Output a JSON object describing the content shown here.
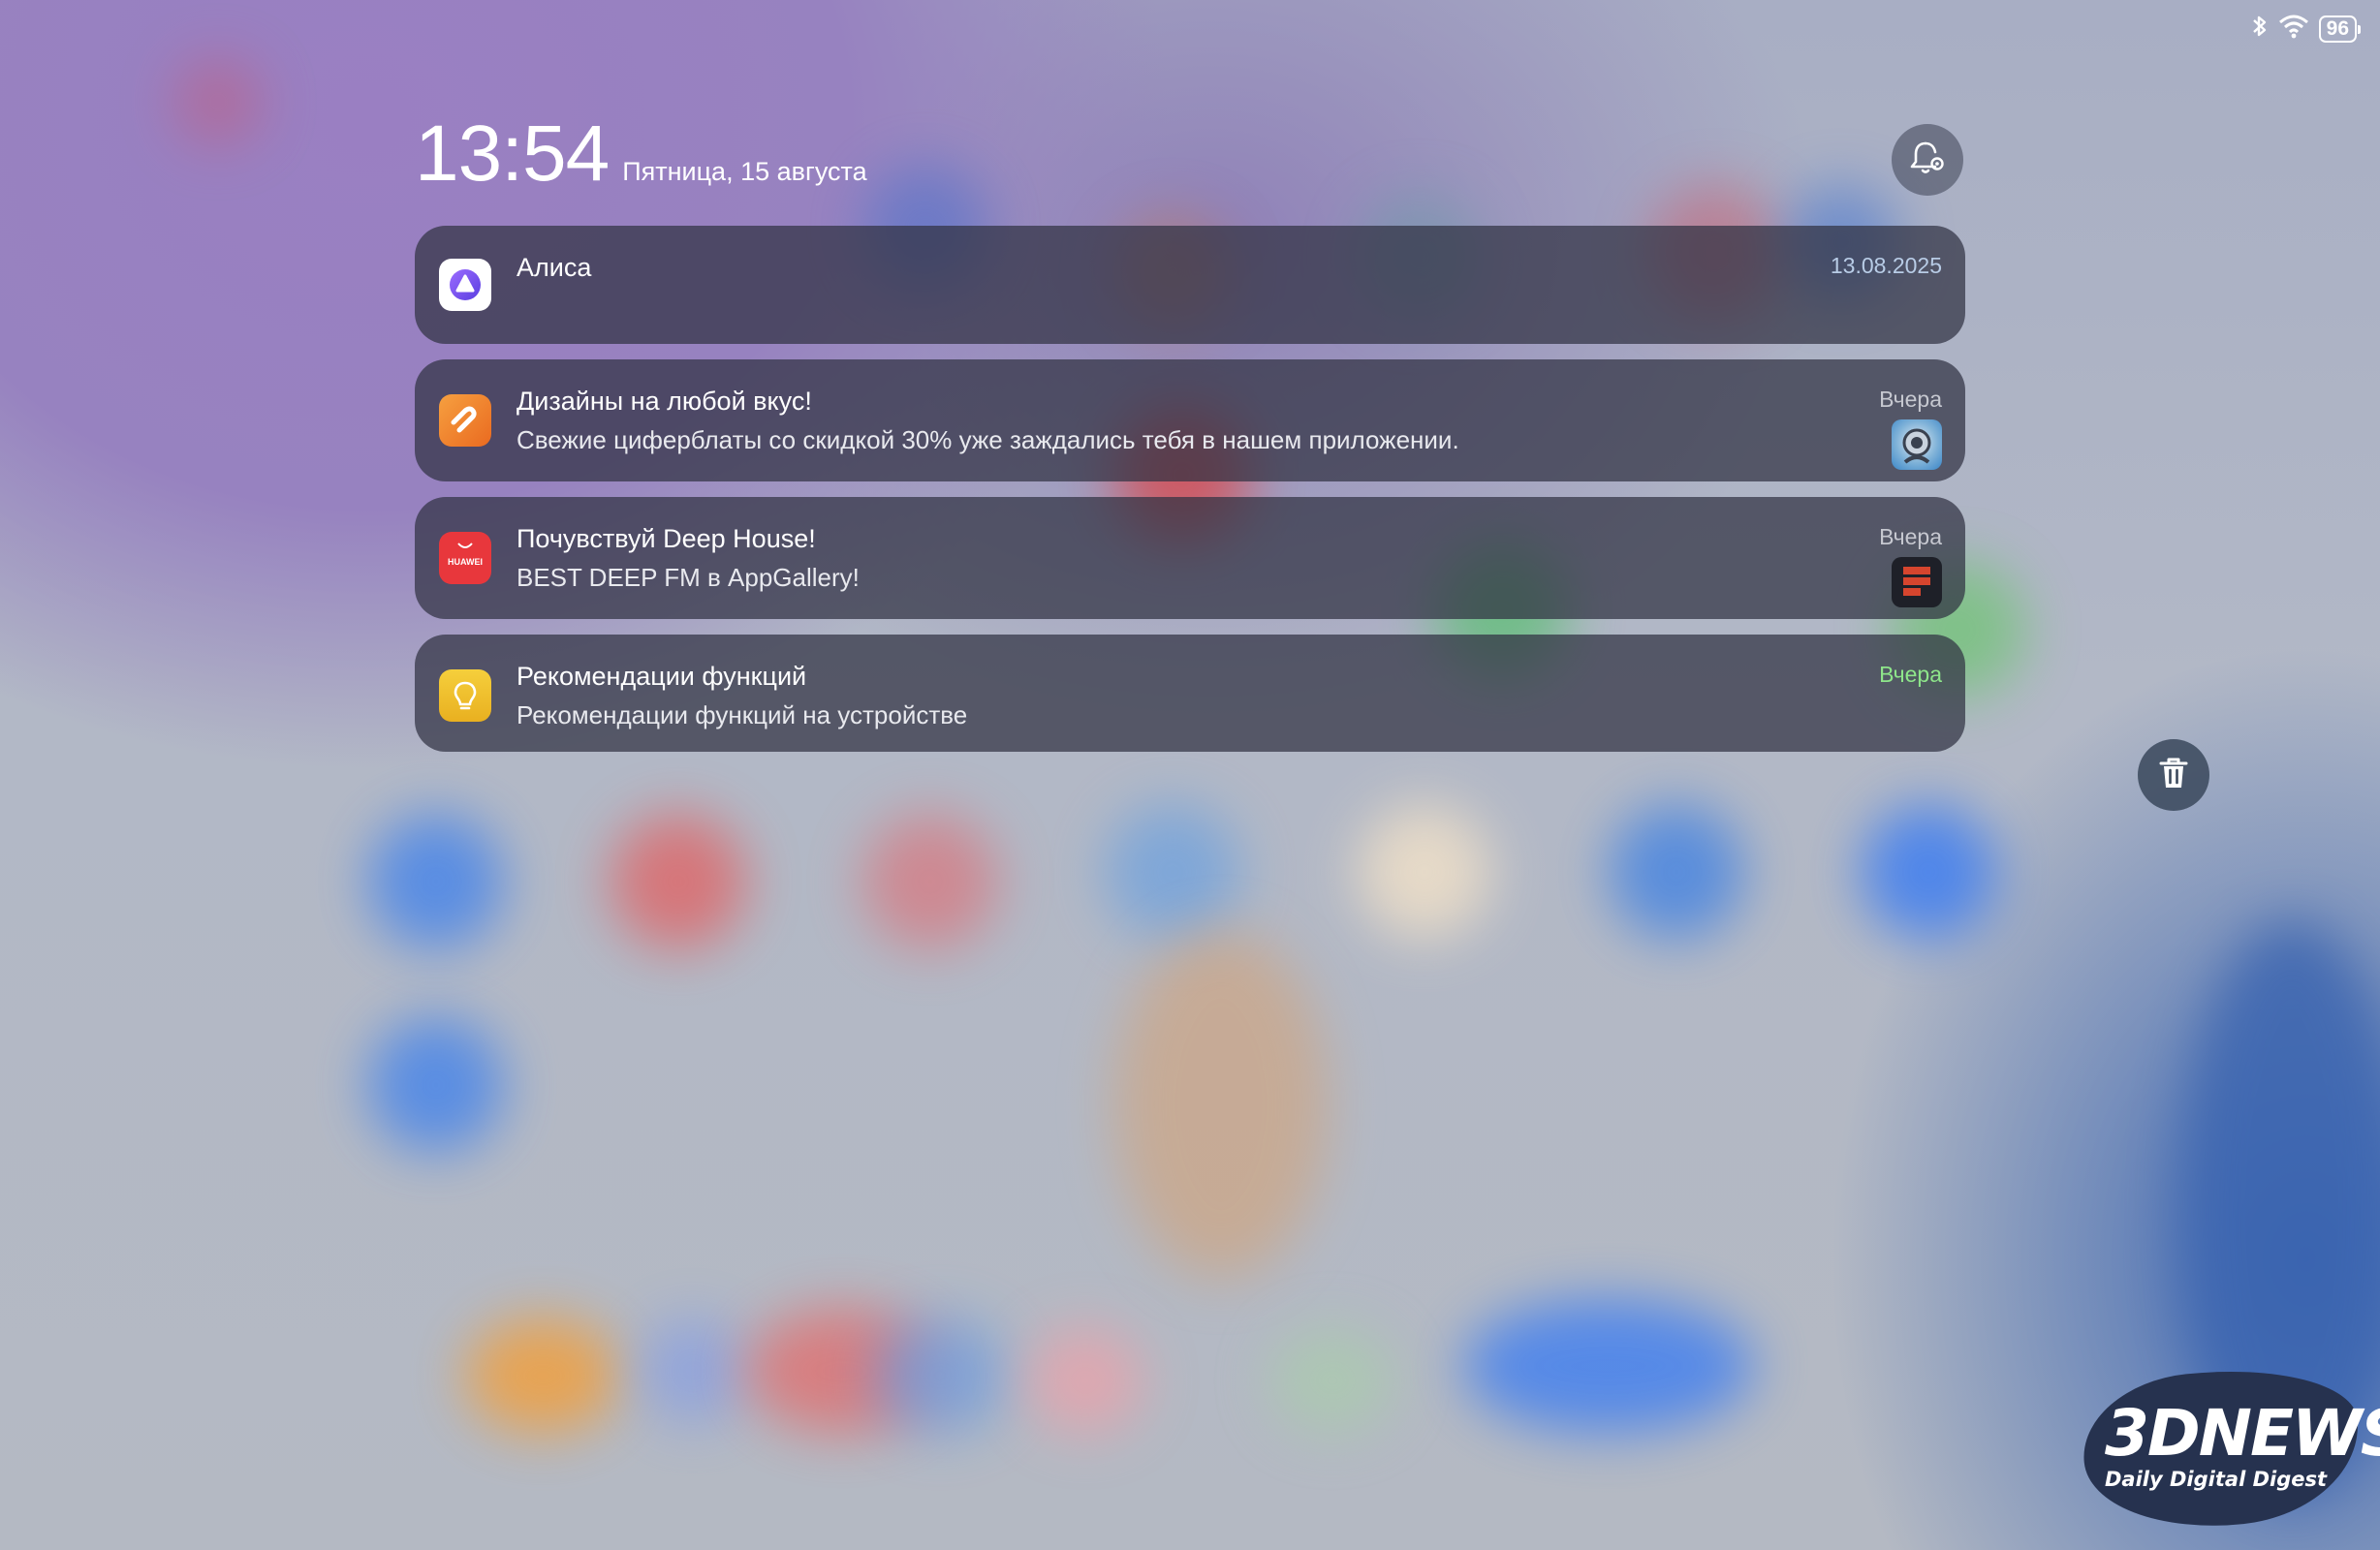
{
  "status_bar": {
    "bluetooth_icon": "bluetooth-icon",
    "wifi_icon": "wifi-icon",
    "battery_level": "96"
  },
  "lock_header": {
    "time": "13:54",
    "date": "Пятница, 15 августа",
    "settings_icon": "bell-settings-icon"
  },
  "notifications": [
    {
      "app": "Алиса",
      "icon": "alice-app-icon",
      "title": "Алиса",
      "body": "",
      "time": "13.08.2025",
      "time_color": "#b8cce6"
    },
    {
      "app": "Дизайны",
      "icon": "themes-app-icon",
      "title": "Дизайны на любой вкус!",
      "body": "Свежие циферблаты со скидкой 30% уже заждались тебя в нашем приложении.",
      "time": "Вчера",
      "thumbnail": "watchface-thumbnail"
    },
    {
      "app": "AppGallery",
      "icon": "huawei-appgallery-icon",
      "icon_label": "HUAWEI",
      "title": "Почувствуй Deep House!",
      "body": "BEST DEEP FM в AppGallery!",
      "time": "Вчера",
      "thumbnail": "best-deep-fm-thumbnail"
    },
    {
      "app": "Советы",
      "icon": "tips-lightbulb-icon",
      "title": "Рекомендации функций",
      "body": "Рекомендации функций на устройстве",
      "time": "Вчера",
      "time_color": "#8ee58a"
    }
  ],
  "clear_all": {
    "icon": "trash-icon"
  },
  "watermark": {
    "logo": "3DNEWS",
    "tagline": "Daily Digital Digest"
  },
  "colors": {
    "card_background": "#30324a",
    "accent_green": "#8ee58a",
    "huawei_red": "#e8373c",
    "themes_orange": "#f08a2c",
    "tips_yellow": "#f2c12e",
    "alice_purple": "#7a5cf0"
  }
}
